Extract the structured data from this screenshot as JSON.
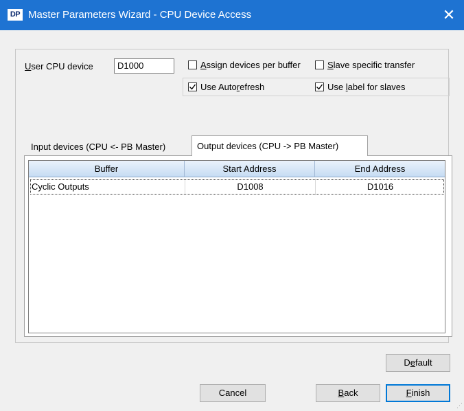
{
  "window": {
    "icon_text": "DP",
    "title": "Master Parameters Wizard - CPU Device Access",
    "close_glyph": "✕"
  },
  "cpu_device": {
    "label": "User CPU device",
    "value": "D1000"
  },
  "options": {
    "assign_per_buffer": {
      "label": "Assign devices per buffer",
      "checked": false
    },
    "slave_specific": {
      "label": "Slave specific transfer",
      "checked": false
    },
    "use_autorefresh": {
      "label": "Use Autorefresh",
      "checked": true
    },
    "use_label_slaves": {
      "label": "Use label for slaves",
      "checked": true
    }
  },
  "tabs": [
    {
      "label": "Input devices (CPU <- PB Master)",
      "active": false
    },
    {
      "label": "Output devices (CPU -> PB Master)",
      "active": true
    }
  ],
  "grid": {
    "columns": [
      "Buffer",
      "Start Address",
      "End Address"
    ],
    "rows": [
      [
        "Cyclic Outputs",
        "D1008",
        "D1016"
      ]
    ]
  },
  "buttons": {
    "default": "Default",
    "cancel": "Cancel",
    "back": "Back",
    "finish": "Finish"
  },
  "colors": {
    "titlebar": "#1e73d2",
    "focus_border": "#0078d7"
  }
}
